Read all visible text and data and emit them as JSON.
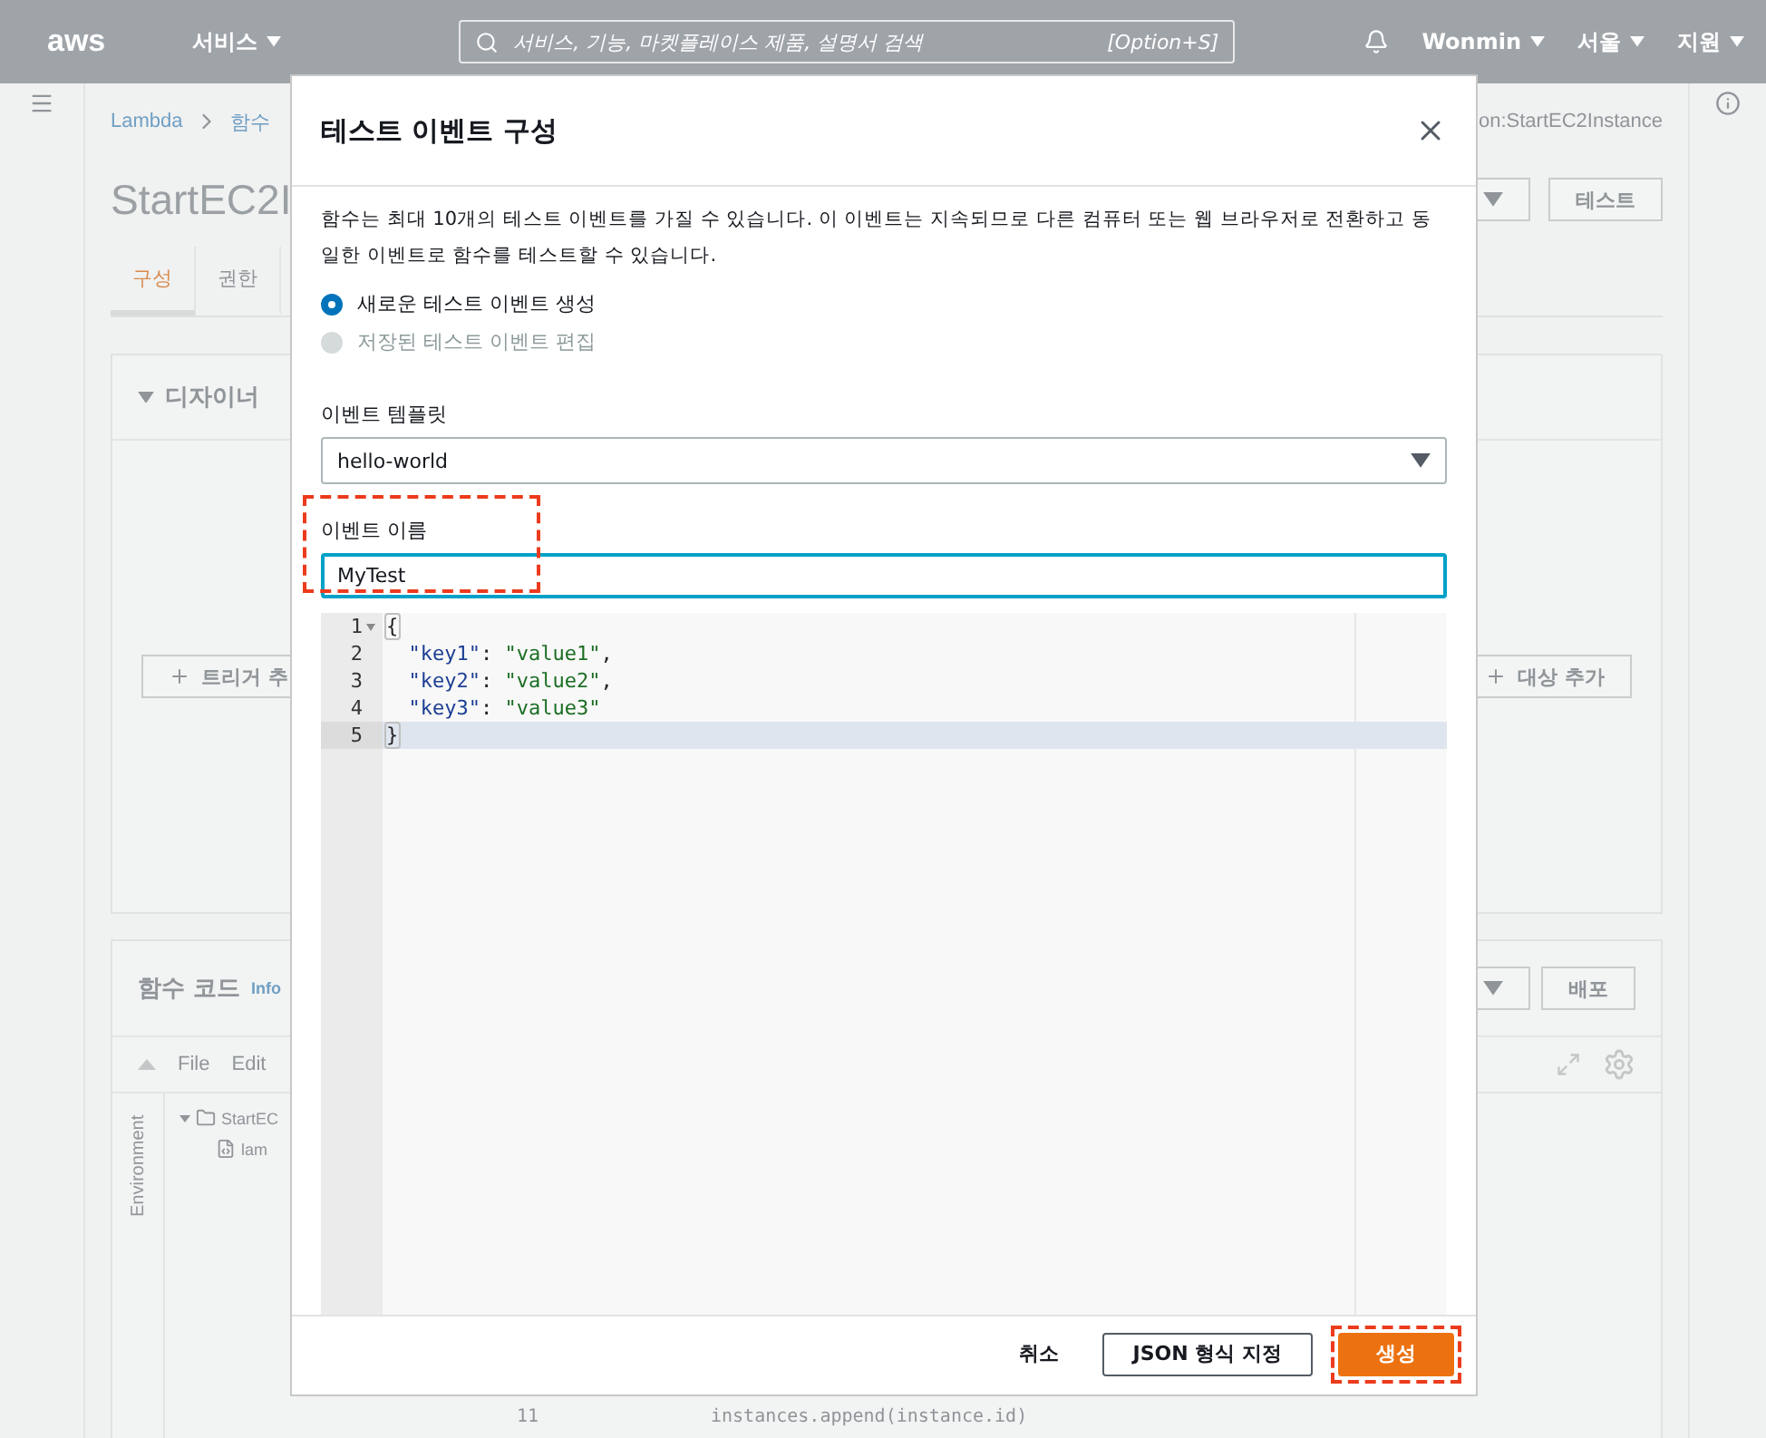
{
  "nav": {
    "logo": "aws",
    "services": "서비스",
    "search_placeholder": "서비스, 기능, 마켓플레이스 제품, 설명서 검색",
    "shortcut": "[Option+S]",
    "user": "Wonmin",
    "region": "서울",
    "support": "지원"
  },
  "breadcrumb": [
    "Lambda",
    "함수"
  ],
  "arn_tail": "on:StartEC2Instance",
  "page_title": "StartEC2I",
  "test_button": "테스트",
  "tabs": [
    {
      "label": "구성",
      "selected": true
    },
    {
      "label": "권한",
      "selected": false
    }
  ],
  "designer": {
    "title": "디자이너",
    "add_trigger": "트리거 추",
    "add_destination": "대상 추가"
  },
  "code_panel": {
    "title": "함수 코드",
    "info": "Info",
    "deploy": "배포",
    "menu": [
      "File",
      "Edit"
    ],
    "side_tab": "Environment",
    "tree": [
      {
        "label": "StartEC",
        "kind": "folder",
        "expanded": true,
        "children": [
          {
            "label": "lam",
            "kind": "file"
          }
        ]
      }
    ],
    "lines": [
      {
        "number": "11",
        "code": "instances.append(instance.id)"
      }
    ]
  },
  "dialog": {
    "title": "테스트 이벤트 구성",
    "description": "함수는 최대 10개의 테스트 이벤트를 가질 수 있습니다. 이 이벤트는 지속되므로 다른 컴퓨터 또는 웹 브라우저로 전환하고 동일한 이벤트로 함수를 테스트할 수 있습니다.",
    "options": [
      {
        "label": "새로운 테스트 이벤트 생성",
        "selected": true,
        "disabled": false
      },
      {
        "label": "저장된 테스트 이벤트 편집",
        "selected": false,
        "disabled": true
      }
    ],
    "template": {
      "label": "이벤트 템플릿",
      "value": "hello-world"
    },
    "name": {
      "label": "이벤트 이름",
      "value": "MyTest",
      "highlighted": true
    },
    "editor": [
      {
        "number": "1",
        "foldable": true,
        "active": false,
        "tokens": [
          {
            "text": "{",
            "kind": "bracket"
          }
        ]
      },
      {
        "number": "2",
        "foldable": false,
        "active": false,
        "tokens": [
          {
            "text": "  \"key1\"",
            "kind": "key"
          },
          {
            "text": ": ",
            "kind": "punct"
          },
          {
            "text": "\"value1\"",
            "kind": "string"
          },
          {
            "text": ",",
            "kind": "punct"
          }
        ]
      },
      {
        "number": "3",
        "foldable": false,
        "active": false,
        "tokens": [
          {
            "text": "  \"key2\"",
            "kind": "key"
          },
          {
            "text": ": ",
            "kind": "punct"
          },
          {
            "text": "\"value2\"",
            "kind": "string"
          },
          {
            "text": ",",
            "kind": "punct"
          }
        ]
      },
      {
        "number": "4",
        "foldable": false,
        "active": false,
        "tokens": [
          {
            "text": "  \"key3\"",
            "kind": "key"
          },
          {
            "text": ": ",
            "kind": "punct"
          },
          {
            "text": "\"value3\"",
            "kind": "string"
          }
        ]
      },
      {
        "number": "5",
        "foldable": false,
        "active": true,
        "tokens": [
          {
            "text": "}",
            "kind": "bracket"
          }
        ]
      }
    ],
    "cancel": "취소",
    "format": "JSON 형식 지정",
    "create": {
      "label": "생성",
      "highlighted": true
    }
  }
}
